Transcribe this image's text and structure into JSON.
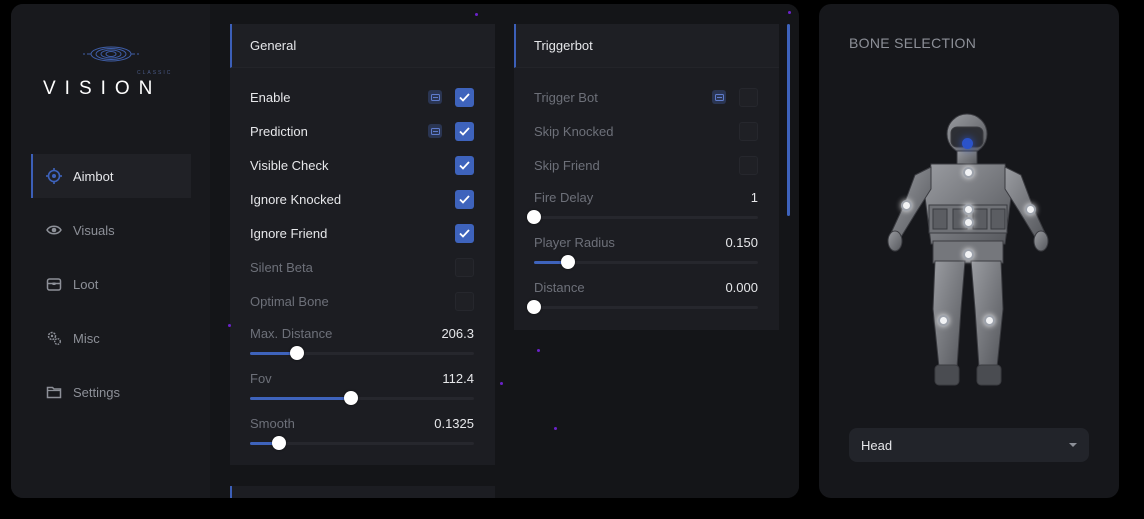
{
  "brand": {
    "name": "VISION",
    "sub": "CLASSIC"
  },
  "colors": {
    "accent": "#3e63bc",
    "bone_selected": "#2b53c9"
  },
  "nav": [
    {
      "label": "Aimbot",
      "icon": "crosshair-icon",
      "active": true
    },
    {
      "label": "Visuals",
      "icon": "eye-icon",
      "active": false
    },
    {
      "label": "Loot",
      "icon": "lootbox-icon",
      "active": false
    },
    {
      "label": "Misc",
      "icon": "gear-cluster-icon",
      "active": false
    },
    {
      "label": "Settings",
      "icon": "folder-icon",
      "active": false
    }
  ],
  "general": {
    "title": "General",
    "toggles": [
      {
        "label": "Enable",
        "checked": true,
        "keybind": true
      },
      {
        "label": "Prediction",
        "checked": true,
        "keybind": true
      },
      {
        "label": "Visible Check",
        "checked": true,
        "keybind": false
      },
      {
        "label": "Ignore Knocked",
        "checked": true,
        "keybind": false
      },
      {
        "label": "Ignore Friend",
        "checked": true,
        "keybind": false
      },
      {
        "label": "Silent Beta",
        "checked": false,
        "keybind": false
      },
      {
        "label": "Optimal Bone",
        "checked": false,
        "keybind": false
      }
    ],
    "sliders": [
      {
        "label": "Max. Distance",
        "value": "206.3",
        "fraction": 0.21
      },
      {
        "label": "Fov",
        "value": "112.4",
        "fraction": 0.45
      },
      {
        "label": "Smooth",
        "value": "0.1325",
        "fraction": 0.13
      }
    ]
  },
  "triggerbot": {
    "title": "Triggerbot",
    "toggles": [
      {
        "label": "Trigger Bot",
        "checked": false,
        "keybind": true
      },
      {
        "label": "Skip Knocked",
        "checked": false,
        "keybind": false
      },
      {
        "label": "Skip Friend",
        "checked": false,
        "keybind": false
      }
    ],
    "sliders": [
      {
        "label": "Fire Delay",
        "value": "1",
        "fraction": 0.0
      },
      {
        "label": "Player Radius",
        "value": "0.150",
        "fraction": 0.15
      },
      {
        "label": "Distance",
        "value": "0.000",
        "fraction": 0.0
      }
    ]
  },
  "bone_selection": {
    "title": "BONE SELECTION",
    "selected": "Head",
    "bones": [
      "head",
      "neck",
      "chest",
      "left-hand",
      "right-hand",
      "stomach",
      "pelvis",
      "left-knee",
      "right-knee"
    ]
  }
}
